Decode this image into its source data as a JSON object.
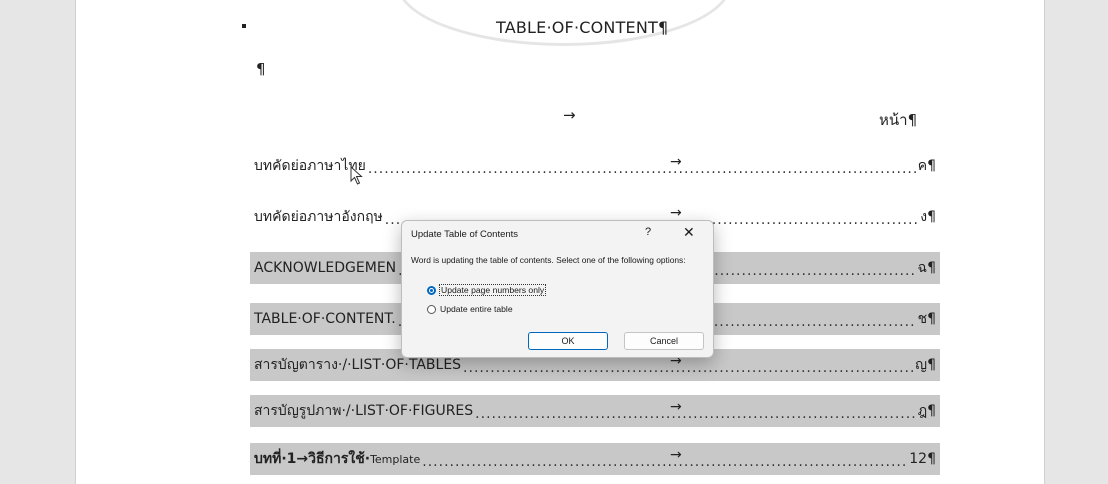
{
  "document": {
    "title": "TABLE·OF·CONTENT¶",
    "empty_paragraph": "¶",
    "header_arrow": "→",
    "page_header": "หน้า¶",
    "toc": [
      {
        "label": "บทคัดย่อภาษาไทย",
        "arrow": "→",
        "page": "ค¶",
        "shaded": false
      },
      {
        "label": "บทคัดย่อภาษาอังกฤษ",
        "arrow": "→",
        "page": "ง¶",
        "shaded": false
      },
      {
        "label": "ACKNOWLEDGEMEN",
        "arrow": "",
        "page": "ฉ¶",
        "shaded": true
      },
      {
        "label": "TABLE·OF·CONTENT.",
        "arrow": "",
        "page": "ช¶",
        "shaded": true
      },
      {
        "label": "สารบัญตาราง·/·LIST·OF·TABLES",
        "arrow": "→",
        "page": "ญ¶",
        "shaded": true
      },
      {
        "label": "สารบัญรูปภาพ·/·LIST·OF·FIGURES",
        "arrow": "→",
        "page": "ฎ¶",
        "shaded": true
      },
      {
        "label_bold": "บทที่·1→วิธีการใช้·",
        "label_small": "Template",
        "arrow": "→",
        "page": "12¶",
        "shaded": true
      }
    ]
  },
  "dialog": {
    "title": "Update Table of Contents",
    "help": "?",
    "close": "✕",
    "message": "Word is updating the table of contents.  Select one of the following options:",
    "options": [
      {
        "label": "Update page numbers only",
        "selected": true
      },
      {
        "label": "Update entire table",
        "selected": false
      }
    ],
    "ok_label": "OK",
    "cancel_label": "Cancel"
  },
  "colors": {
    "page": "#ffffff",
    "background": "#e6e6e6",
    "toc_shading": "#c8c8c8",
    "accent": "#0067c0"
  },
  "icons": {
    "cursor": "mouse-pointer-icon"
  }
}
